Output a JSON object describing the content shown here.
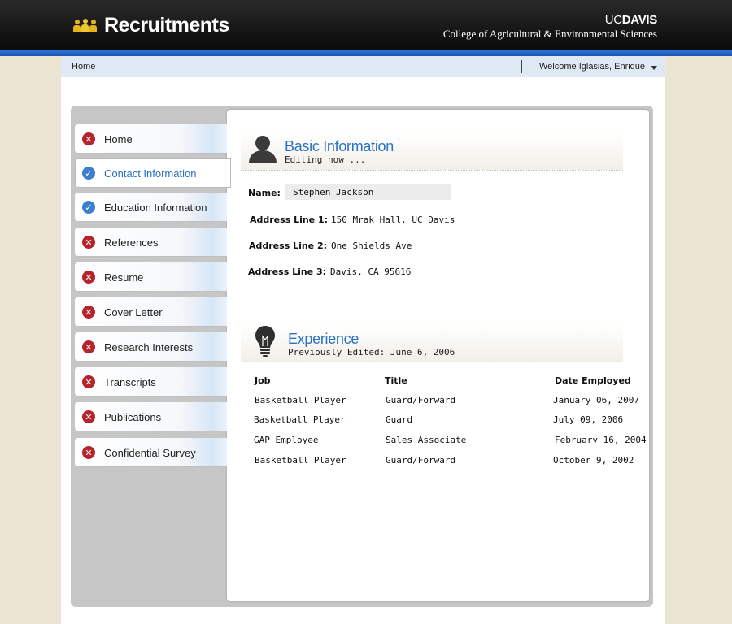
{
  "header": {
    "app_title": "Recruitments",
    "uc_prefix": "UC",
    "uc_bold": "DAVIS",
    "college": "College of Agricultural & Environmental Sciences"
  },
  "topbar": {
    "breadcrumb": "Home",
    "welcome": "Welcome Iglasias, Enrique"
  },
  "nav": {
    "items": [
      {
        "label": "Home",
        "status": "incomplete"
      },
      {
        "label": "Contact Information",
        "status": "complete",
        "active": true
      },
      {
        "label": "Education Information",
        "status": "complete"
      },
      {
        "label": "References",
        "status": "incomplete"
      },
      {
        "label": "Resume",
        "status": "incomplete"
      },
      {
        "label": "Cover Letter",
        "status": "incomplete"
      },
      {
        "label": "Research Interests",
        "status": "incomplete"
      },
      {
        "label": "Transcripts",
        "status": "incomplete"
      },
      {
        "label": "Publications",
        "status": "incomplete"
      },
      {
        "label": "Confidential Survey",
        "status": "incomplete"
      }
    ]
  },
  "basic": {
    "title": "Basic Information",
    "subtitle": "Editing now ...",
    "name_label": "Name:",
    "name_value": "Stephen Jackson",
    "addr1_label": "Address Line 1:",
    "addr1_value": "150 Mrak Hall, UC Davis",
    "addr2_label": "Address Line 2:",
    "addr2_value": "One Shields Ave",
    "addr3_label": "Address Line 3:",
    "addr3_value": "Davis, CA 95616"
  },
  "experience": {
    "title": "Experience",
    "subtitle": "Previously Edited: June 6, 2006",
    "columns": [
      "Job",
      "Title",
      "Date Employed"
    ],
    "rows": [
      [
        "Basketball Player",
        "Guard/Forward",
        "January 06, 2007"
      ],
      [
        "Basketball Player",
        "Guard",
        "July 09, 2006"
      ],
      [
        "GAP Employee",
        "Sales Associate",
        "February 16, 2004"
      ],
      [
        "Basketball Player",
        "Guard/Forward",
        "October 9, 2002"
      ]
    ]
  },
  "icons": {
    "incomplete": "x-circle-icon",
    "complete": "check-circle-icon",
    "colors": {
      "incomplete": "#b8232b",
      "complete": "#3c7fd1",
      "accent": "#2a72c6",
      "stripe": "#2b73d6"
    }
  }
}
